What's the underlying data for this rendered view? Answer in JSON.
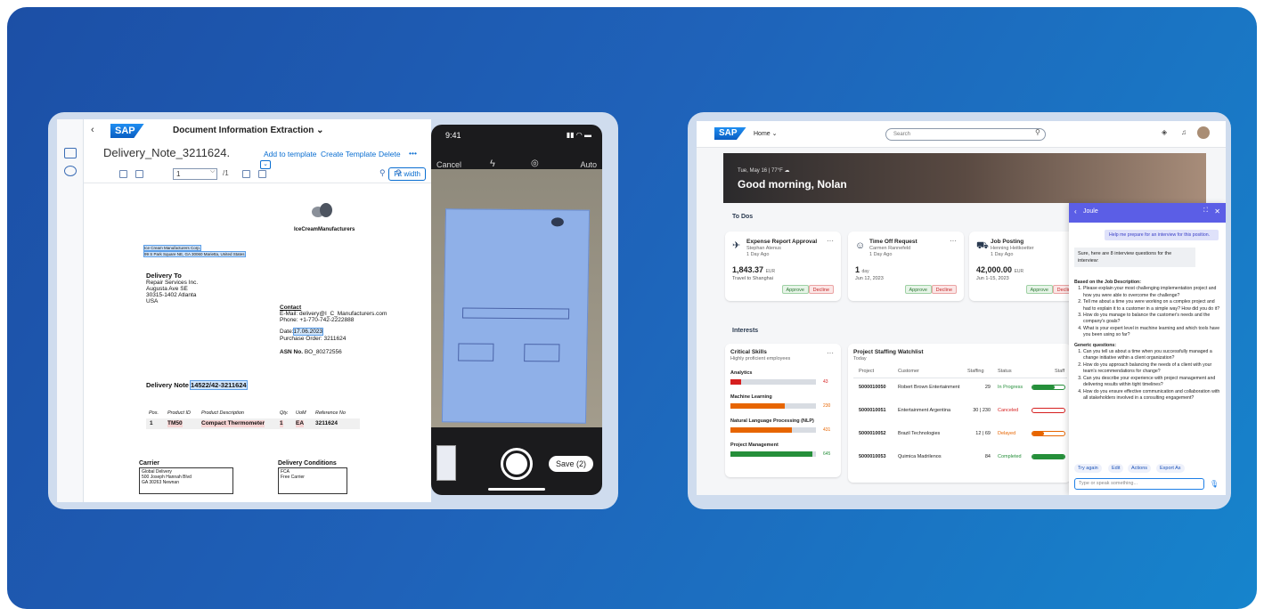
{
  "left_app": {
    "back": "‹",
    "logo": "SAP",
    "title": "Document Information Extraction",
    "title_chevron": "⌄",
    "doc_name": "Delivery_Note_3211624.",
    "actions": {
      "add_to_template": "Add to template",
      "create_template": "Create Template",
      "delete": "Delete",
      "more": "•••"
    },
    "page_input": "1",
    "page_total": "/1",
    "fit_width": "Fit width",
    "doc": {
      "company_logo_text": "IceCreamManufacturers",
      "sender_line1": "Ice Cream Manufacturers Corp.",
      "sender_line2": "99 S Park Square NE, GA 30060 Marietta, United States",
      "delivery_to": "Delivery To",
      "addr1": "Repair Services Inc.",
      "addr2": "Augusta Ave SE",
      "addr3": "30315-1402 Atlanta",
      "addr4": "USA",
      "contact_h": "Contact",
      "email": "E-Mail: delivery@I_C_Manufacturers.com",
      "phone": "Phone: +1-770-742-2222888",
      "date_lbl": "Date:",
      "date_val": "17.06.2023",
      "po": "Purchase Order: 3211624",
      "asn_lbl": "ASN No.",
      "asn_val": "BO_80272556",
      "note_lbl": "Delivery Note",
      "note_val": "14522/42-3211624",
      "cols": [
        "Pos.",
        "Product ID",
        "Product Description",
        "Qty.",
        "UoM",
        "Reference No"
      ],
      "row": [
        "1",
        "TM50",
        "Compact Thermometer",
        "1",
        "EA",
        "3211624"
      ],
      "carrier_h": "Carrier",
      "carrier": [
        "Global Delivery",
        "500 Joseph Hannah Blvd",
        "GA 30263 Newnan"
      ],
      "cond_h": "Delivery Conditions",
      "cond": [
        "FCA",
        "Free Carrier"
      ]
    }
  },
  "phone": {
    "time": "9:41",
    "cancel": "Cancel",
    "auto": "Auto",
    "save": "Save (2)"
  },
  "right_app": {
    "logo": "SAP",
    "home": "Home",
    "search_placeholder": "Search",
    "hero_sub": "Tue, May 16 | 77°F",
    "greeting": "Good morning, Nolan",
    "todos_h": "To Dos",
    "todos": [
      {
        "title": "Expense Report Approval",
        "who": "Stephan Atenus",
        "when": "1 Day Ago",
        "big": "1,843.37",
        "unit": "EUR",
        "small": "Travel to Shanghai",
        "icon": "✈"
      },
      {
        "title": "Time Off Request",
        "who": "Carmen Rannefeld",
        "when": "1 Day Ago",
        "big": "1",
        "unit": "day",
        "small": "Jun 12, 2023",
        "icon": "☺"
      },
      {
        "title": "Job Posting",
        "who": "Henning Heitkoetter",
        "when": "1 Day Ago",
        "big": "42,000.00",
        "unit": "EUR",
        "small": "Jun 1-15, 2023",
        "icon": "⛟"
      }
    ],
    "approve": "Approve",
    "decline": "Decline",
    "interests_h": "Interests",
    "skills": {
      "title": "Critical Skills",
      "subtitle": "Highly proficient employees",
      "items": [
        {
          "label": "Analytics",
          "value": "43",
          "pct": 0.13,
          "color": "#d61f1f"
        },
        {
          "label": "Machine Learning",
          "value": "230",
          "pct": 0.64,
          "color": "#e76500"
        },
        {
          "label": "Natural Language Processing (NLP)",
          "value": "431",
          "pct": 0.72,
          "color": "#e76500"
        },
        {
          "label": "Project Management",
          "value": "645",
          "pct": 0.96,
          "color": "#258f3a"
        }
      ]
    },
    "watch": {
      "title": "Project Staffing Watchlist",
      "subtitle": "Today",
      "cols": [
        "Project",
        "Customer",
        "Staffing",
        "Status",
        "Staff"
      ],
      "rows": [
        {
          "id": "5000010050",
          "customer": "Robert Brown Entertainment",
          "staffing": "29",
          "status": "In Progress",
          "status_color": "#258f3a",
          "fill": 0.7
        },
        {
          "id": "5000010051",
          "customer": "Entertainment Argentina",
          "staffing": "30 | 230",
          "status": "Canceled",
          "status_color": "#d61f1f",
          "fill": 0.0
        },
        {
          "id": "5000010052",
          "customer": "Brazil Technologies",
          "staffing": "12 | 69",
          "status": "Delayed",
          "status_color": "#e76500",
          "fill": 0.35
        },
        {
          "id": "5000010053",
          "customer": "Quimica Madrilenos",
          "staffing": "84",
          "status": "Completed",
          "status_color": "#258f3a",
          "fill": 1.0
        }
      ]
    },
    "joule": {
      "title": "Joule",
      "user_msg": "Help me prepare for an interview for this position.",
      "bot_intro": "Sure, here are 8 interview questions for the interview:",
      "jd_h": "Based on the Job Description:",
      "jd": [
        "Please explain your most challenging implementation project and how you were able to overcome the challenge?",
        "Tell me about a time you were working on a complex project and had to explain it to a customer in a simple way? How did you do it?",
        "How do you manage to balance the customer's needs and the company's goals?",
        "What is your expert level in machine learning and which tools have you been using so far?"
      ],
      "gen_h": "Generic questions:",
      "gen": [
        "Can you tell us about a time when you successfully managed a change initiative within a client organization?",
        "How do you approach balancing the needs of a client with your team's recommendations for change?",
        "Can you describe your experience with project management and delivering results within tight timelines?",
        "How do you ensure effective communication and collaboration with all stakeholders involved in a consulting engagement?"
      ],
      "buttons": [
        "Try again",
        "Edit",
        "Actions",
        "Export As"
      ],
      "input_placeholder": "Type or speak something..."
    }
  }
}
